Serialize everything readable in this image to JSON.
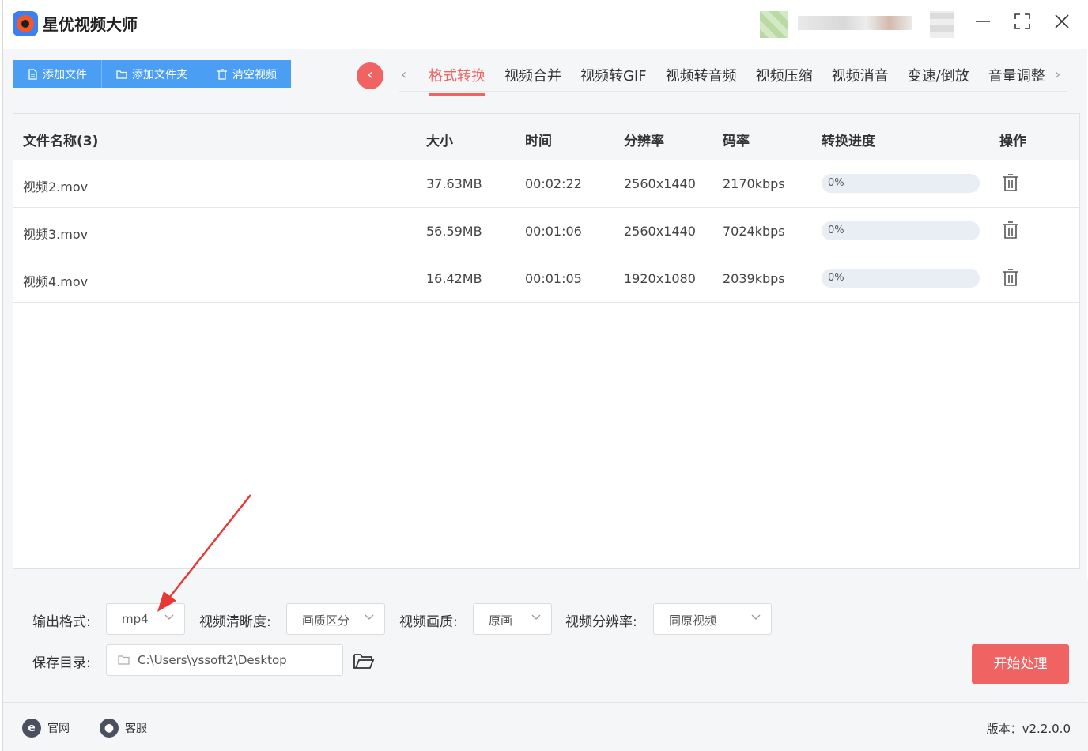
{
  "app": {
    "title": "星优视频大师"
  },
  "window_controls": {
    "minimize": "—",
    "maximize": "⛶",
    "close": "✕"
  },
  "toolbar": {
    "add_file": "添加文件",
    "add_folder": "添加文件夹",
    "clear_videos": "清空视频",
    "accent_color": "#4a9ff5"
  },
  "tabs": [
    {
      "label": "格式转换",
      "active": true
    },
    {
      "label": "视频合并"
    },
    {
      "label": "视频转GIF"
    },
    {
      "label": "视频转音频"
    },
    {
      "label": "视频压缩"
    },
    {
      "label": "视频消音"
    },
    {
      "label": "变速/倒放"
    },
    {
      "label": "音量调整"
    }
  ],
  "table": {
    "headers": {
      "name": "文件名称(3)",
      "size": "大小",
      "duration": "时间",
      "resolution": "分辨率",
      "bitrate": "码率",
      "progress": "转换进度",
      "action": "操作"
    },
    "rows": [
      {
        "name": "视频2.mov",
        "size": "37.63MB",
        "duration": "00:02:22",
        "resolution": "2560x1440",
        "bitrate": "2170kbps",
        "progress": 0,
        "progress_label": "0%"
      },
      {
        "name": "视频3.mov",
        "size": "56.59MB",
        "duration": "00:01:06",
        "resolution": "2560x1440",
        "bitrate": "7024kbps",
        "progress": 0,
        "progress_label": "0%"
      },
      {
        "name": "视频4.mov",
        "size": "16.42MB",
        "duration": "00:01:05",
        "resolution": "1920x1080",
        "bitrate": "2039kbps",
        "progress": 0,
        "progress_label": "0%"
      }
    ]
  },
  "settings": {
    "output_format_label": "输出格式:",
    "output_format_value": "mp4",
    "clarity_label": "视频清晰度:",
    "clarity_value": "画质区分",
    "quality_label": "视频画质:",
    "quality_value": "原画",
    "resolution_label": "视频分辨率:",
    "resolution_value": "同原视频",
    "save_dir_label": "保存目录:",
    "save_dir_value": "C:\\Users\\yssoft2\\Desktop",
    "start_button": "开始处理",
    "start_color": "#f06363"
  },
  "footer": {
    "website": "官网",
    "support": "客服",
    "version": "版本：v2.2.0.0"
  }
}
